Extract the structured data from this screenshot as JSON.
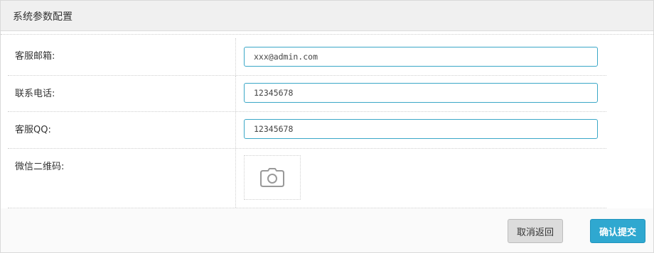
{
  "panel": {
    "title": "系统参数配置"
  },
  "form": {
    "email": {
      "label": "客服邮箱:",
      "value": "xxx@admin.com"
    },
    "phone": {
      "label": "联系电话:",
      "value": "12345678"
    },
    "qq": {
      "label": "客服QQ:",
      "value": "12345678"
    },
    "wechat_qr": {
      "label": "微信二维码:",
      "icon": "camera-icon"
    }
  },
  "actions": {
    "cancel_label": "取消返回",
    "submit_label": "确认提交"
  },
  "colors": {
    "accent": "#2fa8d0",
    "input_border": "#3aa7c7",
    "cancel_bg": "#dcdcdc"
  }
}
